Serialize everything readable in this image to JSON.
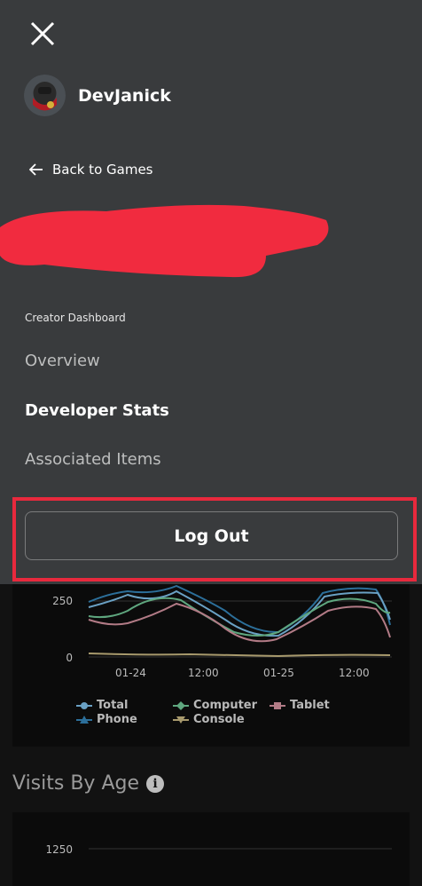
{
  "header": {
    "close_icon": "close-icon"
  },
  "profile": {
    "username": "DevJanick",
    "avatar_icon": "avatar-icon"
  },
  "back": {
    "label": "Back to Games",
    "icon": "arrow-left-icon"
  },
  "redacted_color": "#f12b3f",
  "dashboard": {
    "section_label": "Creator Dashboard",
    "items": [
      {
        "label": "Overview",
        "active": false
      },
      {
        "label": "Developer Stats",
        "active": true
      },
      {
        "label": "Associated Items",
        "active": false
      }
    ]
  },
  "logout": {
    "label": "Log Out",
    "highlight_color": "#e8293d"
  },
  "visits_chart": {
    "y_ticks": [
      "250",
      "0"
    ],
    "x_ticks": [
      "01-24",
      "12:00",
      "01-25",
      "12:00"
    ],
    "legend": [
      {
        "label": "Total",
        "color": "#6aa1c4"
      },
      {
        "label": "Computer",
        "color": "#5fa77f"
      },
      {
        "label": "Tablet",
        "color": "#b27b86"
      },
      {
        "label": "Phone",
        "color": "#2c6f9a"
      },
      {
        "label": "Console",
        "color": "#a89a6d"
      }
    ]
  },
  "visits_by_age": {
    "title": "Visits By Age",
    "info_icon": "info-icon",
    "y_tick": "1250"
  },
  "chart_data": {
    "type": "line",
    "x": [
      "01-24",
      "12:00",
      "01-25",
      "12:00"
    ],
    "ylabel": "",
    "series": [
      {
        "name": "Total",
        "values": [
          290,
          260,
          300,
          150,
          310,
          250
        ]
      },
      {
        "name": "Computer",
        "values": [
          200,
          180,
          280,
          120,
          250,
          220
        ]
      },
      {
        "name": "Tablet",
        "values": [
          150,
          140,
          220,
          90,
          200,
          160
        ]
      },
      {
        "name": "Phone",
        "values": [
          270,
          240,
          290,
          130,
          300,
          240
        ]
      },
      {
        "name": "Console",
        "values": [
          10,
          8,
          12,
          6,
          10,
          8
        ]
      }
    ]
  }
}
